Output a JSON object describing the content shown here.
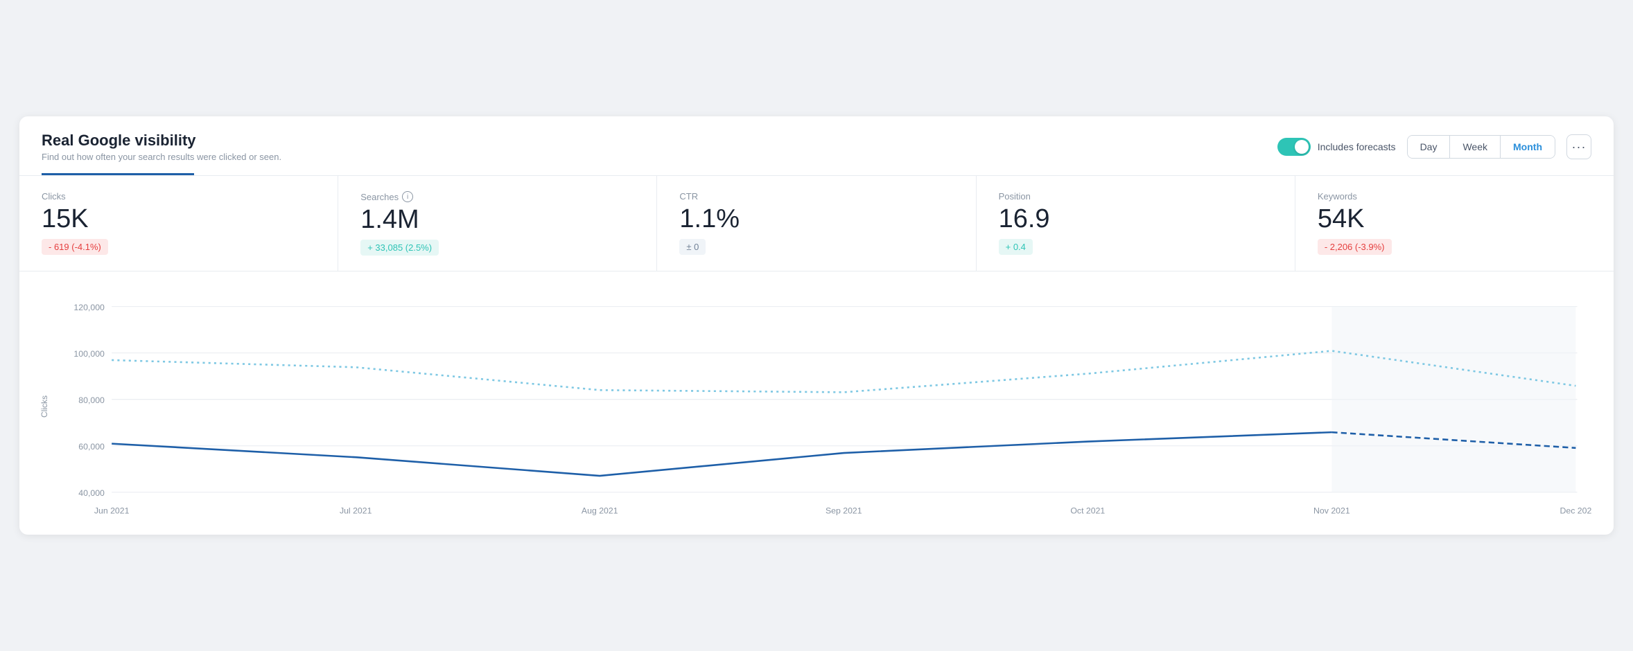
{
  "header": {
    "title": "Real Google visibility",
    "subtitle": "Find out how often your search results were clicked or seen.",
    "toggle_label": "Includes forecasts",
    "toggle_active": true,
    "period_buttons": [
      "Day",
      "Week",
      "Month"
    ],
    "active_period": "Month",
    "more_btn_label": "···"
  },
  "metrics": [
    {
      "label": "Clicks",
      "value": "15K",
      "badge": "- 619 (-4.1%)",
      "badge_type": "red",
      "has_info": false
    },
    {
      "label": "Searches",
      "value": "1.4M",
      "badge": "+ 33,085 (2.5%)",
      "badge_type": "green",
      "has_info": true
    },
    {
      "label": "CTR",
      "value": "1.1%",
      "badge": "± 0",
      "badge_type": "neutral",
      "has_info": false
    },
    {
      "label": "Position",
      "value": "16.9",
      "badge": "+ 0.4",
      "badge_type": "green",
      "has_info": false
    },
    {
      "label": "Keywords",
      "value": "54K",
      "badge": "- 2,206 (-3.9%)",
      "badge_type": "red",
      "has_info": false
    }
  ],
  "chart": {
    "y_label": "Clicks",
    "y_ticks": [
      "120,000",
      "100,000",
      "80,000",
      "60,000",
      "40,000"
    ],
    "x_ticks": [
      "Jun 2021",
      "Jul 2021",
      "Aug 2021",
      "Sep 2021",
      "Oct 2021",
      "Nov 2021",
      "Dec 202"
    ],
    "solid_line": [
      {
        "x": 0,
        "y": 61000
      },
      {
        "x": 1,
        "y": 55000
      },
      {
        "x": 2,
        "y": 47000
      },
      {
        "x": 2.3,
        "y": 48000
      },
      {
        "x": 3,
        "y": 57000
      },
      {
        "x": 4,
        "y": 62000
      },
      {
        "x": 5,
        "y": 66000
      }
    ],
    "dashed_line": [
      {
        "x": 5,
        "y": 66000
      },
      {
        "x": 6,
        "y": 59000
      }
    ],
    "dotted_line": [
      {
        "x": 0,
        "y": 97000
      },
      {
        "x": 1,
        "y": 94000
      },
      {
        "x": 2,
        "y": 84000
      },
      {
        "x": 3,
        "y": 83000
      },
      {
        "x": 4,
        "y": 91000
      },
      {
        "x": 5,
        "y": 101000
      },
      {
        "x": 6,
        "y": 86000
      }
    ]
  }
}
